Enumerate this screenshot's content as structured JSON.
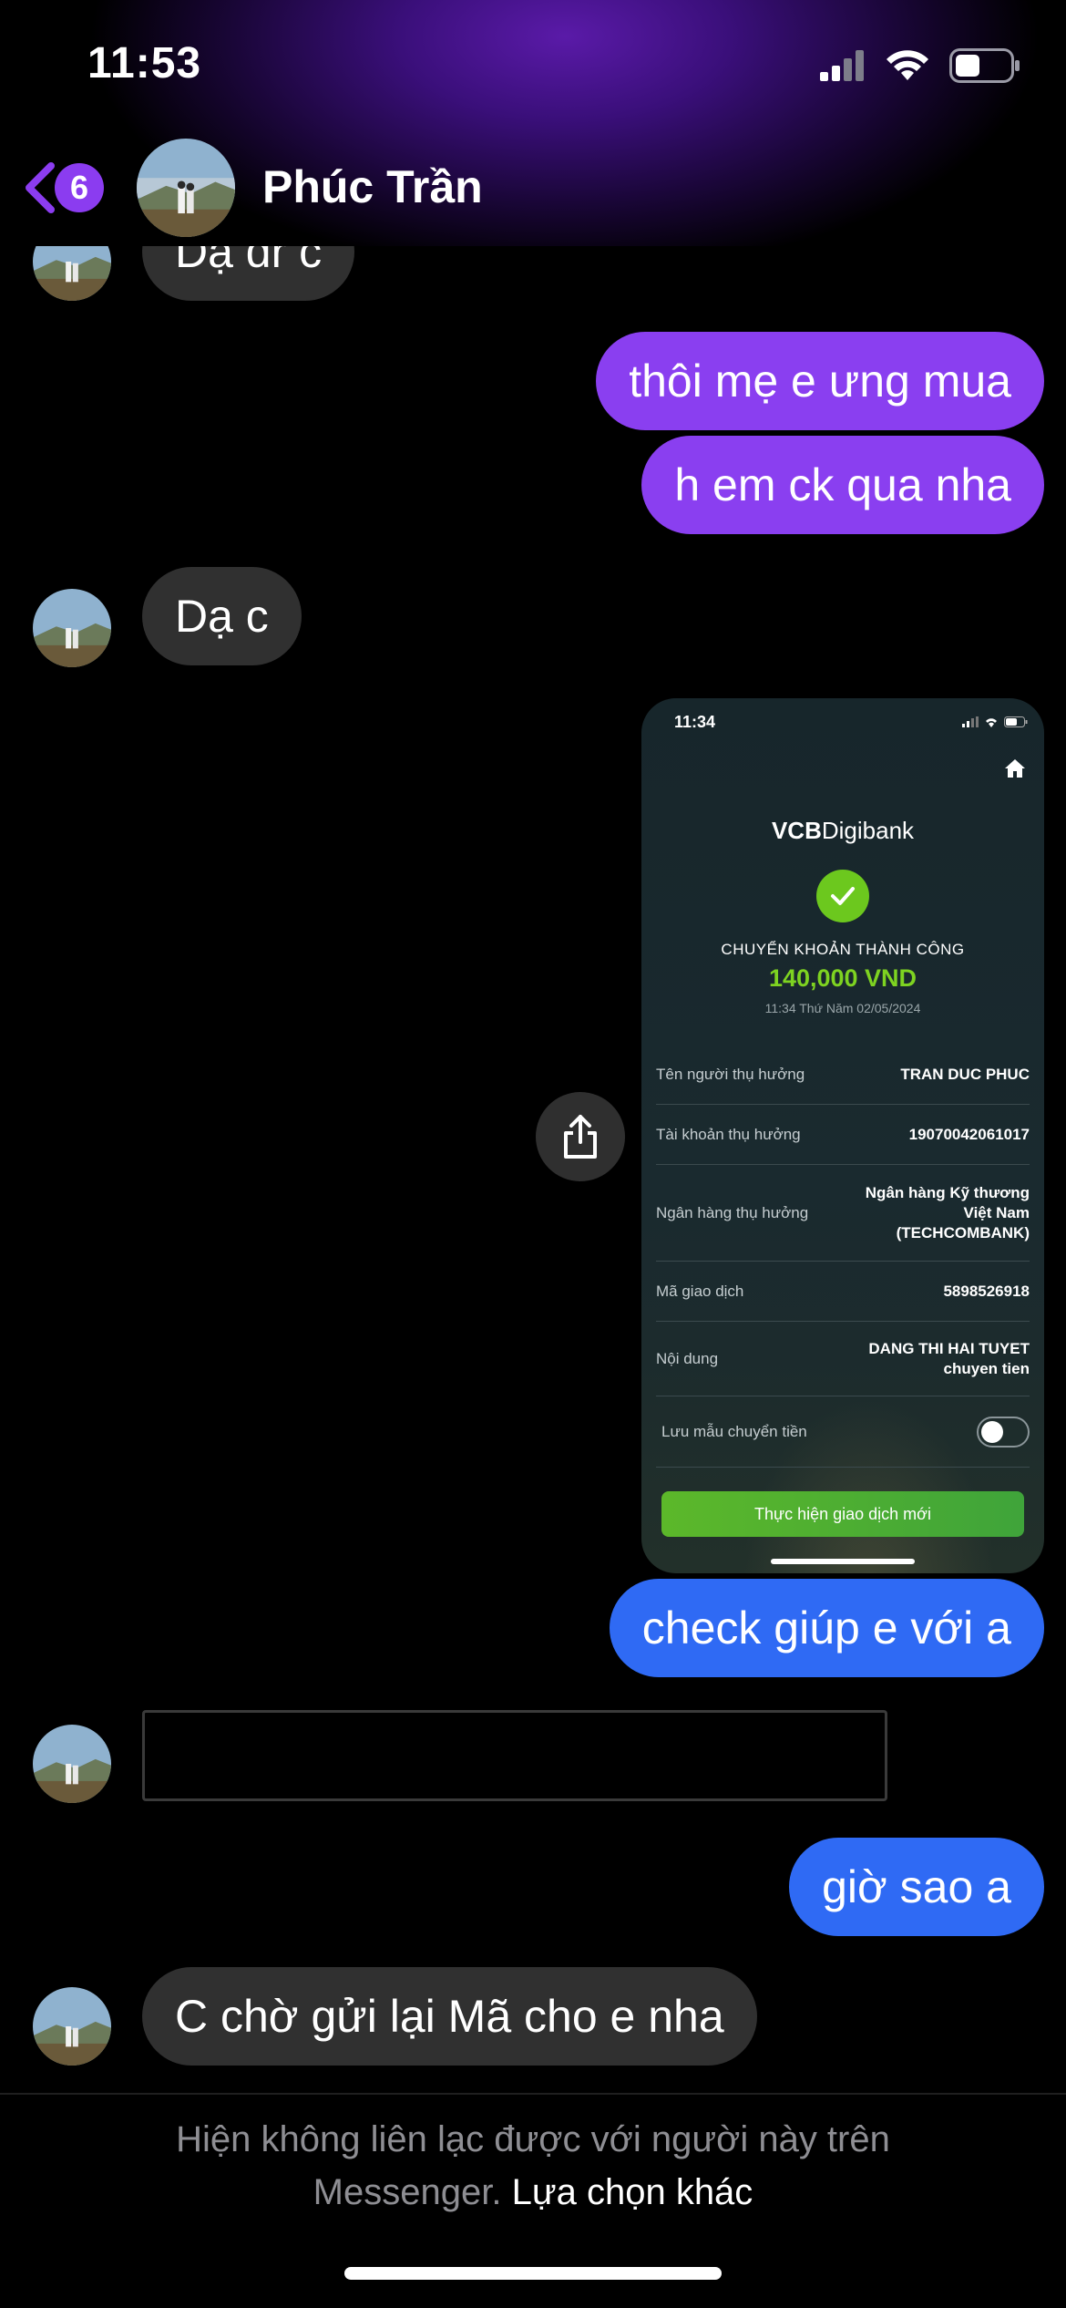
{
  "status_bar": {
    "time": "11:53"
  },
  "header": {
    "back_count": "6",
    "contact_name": "Phúc Trần"
  },
  "messages": {
    "m0": "Dạ dr c",
    "m1": "thôi mẹ e ưng mua",
    "m2": "h em ck qua nha",
    "m3": "Dạ c",
    "m5": "check giúp e với a",
    "m7": "giờ sao a",
    "m8": "C chờ gửi lại Mã cho e nha"
  },
  "screenshot": {
    "time": "11:34",
    "brand_bold": "VCB",
    "brand_rest": "Digibank",
    "success_text": "CHUYỂN KHOẢN THÀNH CÔNG",
    "amount": "140,000 VND",
    "date": "11:34 Thứ Năm 02/05/2024",
    "rows": [
      {
        "label": "Tên người thụ hưởng",
        "value": "TRAN DUC PHUC"
      },
      {
        "label": "Tài khoản thụ hưởng",
        "value": "19070042061017"
      },
      {
        "label": "Ngân hàng thụ hưởng",
        "value": "Ngân hàng Kỹ thương Việt Nam (TECHCOMBANK)"
      },
      {
        "label": "Mã giao dịch",
        "value": "5898526918"
      },
      {
        "label": "Nội dung",
        "value": "DANG THI HAI TUYET chuyen tien"
      }
    ],
    "save_template_label": "Lưu mẫu chuyển tiền",
    "new_transaction_button": "Thực hiện giao dịch mới"
  },
  "footer": {
    "line1": "Hiện không liên lạc được với người này trên",
    "line2_prefix": "Messenger.",
    "line2_link": "Lựa chọn khác"
  },
  "colors": {
    "outgoing_purple": "#8a3ff0",
    "outgoing_blue": "#2f6af4",
    "incoming_gray": "#303030",
    "vcb_green": "#7ed321"
  }
}
